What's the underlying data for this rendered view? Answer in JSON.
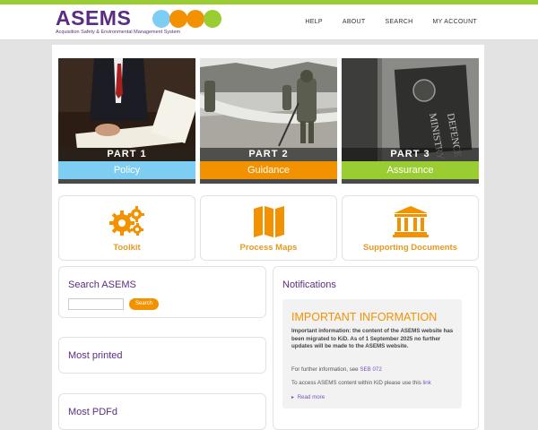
{
  "brand": {
    "name": "ASEMS",
    "subtitle": "Acquisition Safety & Environmental Management System",
    "colors": {
      "blue": "#7ecef4",
      "orange": "#f39200",
      "green": "#9acd32",
      "purple": "#5a2d82"
    }
  },
  "nav": {
    "items": [
      "HELP",
      "ABOUT",
      "SEARCH",
      "MY ACCOUNT"
    ]
  },
  "parts": [
    {
      "number": "PART 1",
      "label": "Policy",
      "color": "#7ecef4"
    },
    {
      "number": "PART 2",
      "label": "Guidance",
      "color": "#f39200"
    },
    {
      "number": "PART 3",
      "label": "Assurance",
      "color": "#9acd32"
    }
  ],
  "tiles": [
    {
      "label": "Toolkit",
      "icon": "gears-icon"
    },
    {
      "label": "Process Maps",
      "icon": "map-icon"
    },
    {
      "label": "Supporting Documents",
      "icon": "building-icon"
    }
  ],
  "search": {
    "title": "Search ASEMS",
    "button": "Search",
    "placeholder": ""
  },
  "most_printed": {
    "title": "Most printed"
  },
  "most_pdfd": {
    "title": "Most PDFd"
  },
  "notifications": {
    "title": "Notifications",
    "important_title": "IMPORTANT INFORMATION",
    "important_text": "Important information: the content of the ASEMS website has been migrated to KiD. As of 1 September 2025 no further updates will be made to the ASEMS website.",
    "further_prefix": "For further information, see",
    "further_link": "SEB 072",
    "access_prefix": "To access ASEMS content within KiD please use this",
    "access_link": "link",
    "read_more": "Read more"
  }
}
